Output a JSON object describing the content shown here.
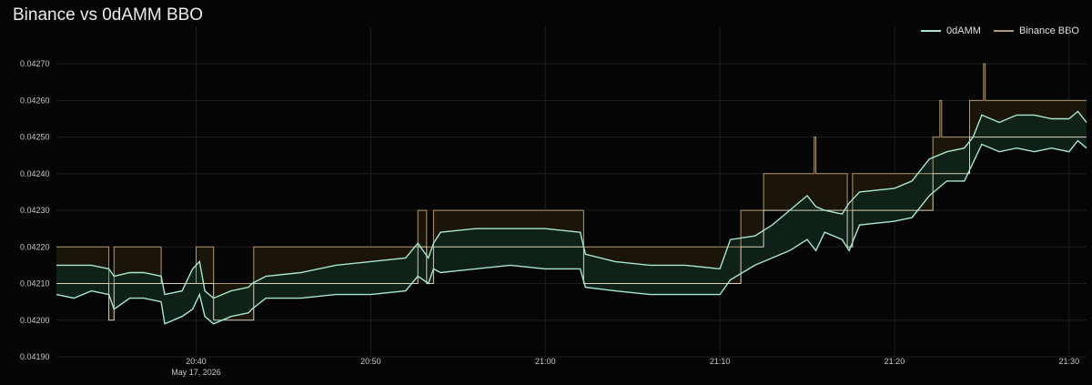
{
  "chart_data": {
    "type": "line",
    "title": "Binance vs 0dAMM BBO",
    "xlabel": "",
    "ylabel": "",
    "date_label": "May 17, 2026",
    "xlim": [
      "20:32",
      "21:31"
    ],
    "ylim": [
      0.0419,
      0.04275
    ],
    "x_ticks": [
      "20:40",
      "20:50",
      "21:00",
      "21:10",
      "21:20",
      "21:30"
    ],
    "y_ticks": [
      "0.04190",
      "0.04200",
      "0.04210",
      "0.04220",
      "0.04230",
      "0.04240",
      "0.04250",
      "0.04260",
      "0.04270"
    ],
    "grid": true,
    "legend_position": "top-right",
    "colors": {
      "background": "#050505",
      "grid": "#1e1e1e",
      "odamm": "#a8e6cf",
      "odamm_fill": "#0f2419",
      "binance": "#b09a70",
      "binance_fill": "#1b1509"
    },
    "series": [
      {
        "name": "0dAMM",
        "color": "#a8e6cf",
        "bid": [
          [
            "20:32",
            0.04207
          ],
          [
            "20:33",
            0.04206
          ],
          [
            "20:34",
            0.04208
          ],
          [
            "20:35",
            0.04207
          ],
          [
            "20:35.3",
            0.04203
          ],
          [
            "20:36.2",
            0.04206
          ],
          [
            "20:37",
            0.04206
          ],
          [
            "20:38",
            0.04205
          ],
          [
            "20:38.2",
            0.04199
          ],
          [
            "20:39.2",
            0.04201
          ],
          [
            "20:39.8",
            0.04203
          ],
          [
            "20:40.2",
            0.04207
          ],
          [
            "20:40.5",
            0.04201
          ],
          [
            "20:41",
            0.04199
          ],
          [
            "20:42",
            0.04201
          ],
          [
            "20:43",
            0.04202
          ],
          [
            "20:43.2",
            0.04203
          ],
          [
            "20:44",
            0.04206
          ],
          [
            "20:46",
            0.04206
          ],
          [
            "20:48",
            0.04207
          ],
          [
            "20:50",
            0.04207
          ],
          [
            "20:52",
            0.04208
          ],
          [
            "20:52.7",
            0.04212
          ],
          [
            "20:53.3",
            0.0421
          ],
          [
            "20:53.6",
            0.04214
          ],
          [
            "20:54",
            0.04213
          ],
          [
            "20:56",
            0.04214
          ],
          [
            "20:58",
            0.04215
          ],
          [
            "21:00",
            0.04214
          ],
          [
            "21:02",
            0.04214
          ],
          [
            "21:02.3",
            0.04209
          ],
          [
            "21:04",
            0.04208
          ],
          [
            "21:06",
            0.04207
          ],
          [
            "21:08",
            0.04207
          ],
          [
            "21:10",
            0.04207
          ],
          [
            "21:10.6",
            0.04211
          ],
          [
            "21:12",
            0.04215
          ],
          [
            "21:13",
            0.04217
          ],
          [
            "21:14",
            0.04219
          ],
          [
            "21:15",
            0.04222
          ],
          [
            "21:15.5",
            0.04219
          ],
          [
            "21:16",
            0.04224
          ],
          [
            "21:17",
            0.04222
          ],
          [
            "21:17.4",
            0.04219
          ],
          [
            "21:18",
            0.04226
          ],
          [
            "21:20",
            0.04227
          ],
          [
            "21:21",
            0.04228
          ],
          [
            "21:22",
            0.04234
          ],
          [
            "21:23",
            0.04238
          ],
          [
            "21:24",
            0.04238
          ],
          [
            "21:24.5",
            0.04243
          ],
          [
            "21:25",
            0.04248
          ],
          [
            "21:26",
            0.04246
          ],
          [
            "21:27",
            0.04247
          ],
          [
            "21:28",
            0.04246
          ],
          [
            "21:29",
            0.04247
          ],
          [
            "21:30",
            0.04246
          ],
          [
            "21:30.5",
            0.04249
          ],
          [
            "21:31",
            0.04247
          ]
        ],
        "ask": [
          [
            "20:32",
            0.04215
          ],
          [
            "20:33",
            0.04215
          ],
          [
            "20:34",
            0.04215
          ],
          [
            "20:35",
            0.04214
          ],
          [
            "20:35.3",
            0.04212
          ],
          [
            "20:36.2",
            0.04213
          ],
          [
            "20:37",
            0.04213
          ],
          [
            "20:38",
            0.04212
          ],
          [
            "20:38.2",
            0.04207
          ],
          [
            "20:39.2",
            0.04208
          ],
          [
            "20:39.8",
            0.04214
          ],
          [
            "20:40.2",
            0.04216
          ],
          [
            "20:40.5",
            0.04208
          ],
          [
            "20:41",
            0.04206
          ],
          [
            "20:42",
            0.04208
          ],
          [
            "20:43",
            0.04209
          ],
          [
            "20:43.2",
            0.0421
          ],
          [
            "20:44",
            0.04212
          ],
          [
            "20:46",
            0.04213
          ],
          [
            "20:48",
            0.04215
          ],
          [
            "20:50",
            0.04216
          ],
          [
            "20:52",
            0.04217
          ],
          [
            "20:52.7",
            0.04221
          ],
          [
            "20:53.3",
            0.04217
          ],
          [
            "20:53.6",
            0.04221
          ],
          [
            "20:54",
            0.04224
          ],
          [
            "20:56",
            0.04225
          ],
          [
            "20:58",
            0.04225
          ],
          [
            "21:00",
            0.04225
          ],
          [
            "21:02",
            0.04224
          ],
          [
            "21:02.3",
            0.04218
          ],
          [
            "21:04",
            0.04216
          ],
          [
            "21:06",
            0.04215
          ],
          [
            "21:08",
            0.04215
          ],
          [
            "21:10",
            0.04214
          ],
          [
            "21:10.6",
            0.04222
          ],
          [
            "21:12",
            0.04223
          ],
          [
            "21:13",
            0.04226
          ],
          [
            "21:14",
            0.0423
          ],
          [
            "21:15",
            0.04234
          ],
          [
            "21:15.5",
            0.04231
          ],
          [
            "21:16",
            0.0423
          ],
          [
            "21:17",
            0.04229
          ],
          [
            "21:17.4",
            0.04232
          ],
          [
            "21:18",
            0.04235
          ],
          [
            "21:20",
            0.04236
          ],
          [
            "21:21",
            0.04238
          ],
          [
            "21:22",
            0.04244
          ],
          [
            "21:23",
            0.04246
          ],
          [
            "21:24",
            0.04247
          ],
          [
            "21:24.5",
            0.0425
          ],
          [
            "21:25",
            0.04256
          ],
          [
            "21:26",
            0.04254
          ],
          [
            "21:27",
            0.04256
          ],
          [
            "21:28",
            0.04256
          ],
          [
            "21:29",
            0.04255
          ],
          [
            "21:30",
            0.04255
          ],
          [
            "21:30.5",
            0.04257
          ],
          [
            "21:31",
            0.04254
          ]
        ]
      },
      {
        "name": "Binance BBO",
        "color": "#b09a70",
        "bid": [
          [
            "20:32",
            0.0421
          ],
          [
            "20:35",
            0.0421
          ],
          [
            "20:35",
            0.042
          ],
          [
            "20:35.3",
            0.042
          ],
          [
            "20:35.3",
            0.0421
          ],
          [
            "20:38",
            0.0421
          ],
          [
            "20:38",
            0.0421
          ],
          [
            "20:40",
            0.0421
          ],
          [
            "20:40",
            0.0421
          ],
          [
            "20:41",
            0.0421
          ],
          [
            "20:41",
            0.042
          ],
          [
            "20:43.3",
            0.042
          ],
          [
            "20:43.3",
            0.0421
          ],
          [
            "20:52.7",
            0.0421
          ],
          [
            "20:52.7",
            0.0422
          ],
          [
            "20:53.2",
            0.0422
          ],
          [
            "20:53.2",
            0.0421
          ],
          [
            "20:53.6",
            0.0421
          ],
          [
            "20:53.6",
            0.0422
          ],
          [
            "21:02.2",
            0.0422
          ],
          [
            "21:02.2",
            0.0421
          ],
          [
            "21:11.2",
            0.0421
          ],
          [
            "21:11.2",
            0.0422
          ],
          [
            "21:12.5",
            0.0422
          ],
          [
            "21:12.5",
            0.0423
          ],
          [
            "21:17.3",
            0.0423
          ],
          [
            "21:17.3",
            0.0422
          ],
          [
            "21:17.6",
            0.0422
          ],
          [
            "21:17.6",
            0.0423
          ],
          [
            "21:22.2",
            0.0423
          ],
          [
            "21:22.2",
            0.0424
          ],
          [
            "21:24.3",
            0.0424
          ],
          [
            "21:24.3",
            0.0425
          ],
          [
            "21:31",
            0.0425
          ]
        ],
        "ask": [
          [
            "20:32",
            0.0422
          ],
          [
            "20:35",
            0.0422
          ],
          [
            "20:35",
            0.0421
          ],
          [
            "20:35.3",
            0.0421
          ],
          [
            "20:35.3",
            0.0422
          ],
          [
            "20:38",
            0.0422
          ],
          [
            "20:38",
            0.0421
          ],
          [
            "20:40",
            0.0421
          ],
          [
            "20:40",
            0.0422
          ],
          [
            "20:41",
            0.0422
          ],
          [
            "20:41",
            0.0421
          ],
          [
            "20:43.3",
            0.0421
          ],
          [
            "20:43.3",
            0.0422
          ],
          [
            "20:52.7",
            0.0422
          ],
          [
            "20:52.7",
            0.0423
          ],
          [
            "20:53.2",
            0.0423
          ],
          [
            "20:53.2",
            0.0422
          ],
          [
            "20:53.6",
            0.0422
          ],
          [
            "20:53.6",
            0.0423
          ],
          [
            "21:02.2",
            0.0423
          ],
          [
            "21:02.2",
            0.0422
          ],
          [
            "21:11.2",
            0.0422
          ],
          [
            "21:11.2",
            0.0423
          ],
          [
            "21:12.5",
            0.0423
          ],
          [
            "21:12.5",
            0.0424
          ],
          [
            "21:15.4",
            0.0424
          ],
          [
            "21:15.4",
            0.0425
          ],
          [
            "21:15.5",
            0.0425
          ],
          [
            "21:15.5",
            0.0424
          ],
          [
            "21:17.3",
            0.0424
          ],
          [
            "21:17.3",
            0.0423
          ],
          [
            "21:17.6",
            0.0423
          ],
          [
            "21:17.6",
            0.0424
          ],
          [
            "21:22.2",
            0.0424
          ],
          [
            "21:22.2",
            0.0425
          ],
          [
            "21:22.6",
            0.0425
          ],
          [
            "21:22.6",
            0.0426
          ],
          [
            "21:22.7",
            0.0426
          ],
          [
            "21:22.7",
            0.0425
          ],
          [
            "21:24.3",
            0.0425
          ],
          [
            "21:24.3",
            0.0426
          ],
          [
            "21:25.1",
            0.0426
          ],
          [
            "21:25.1",
            0.0427
          ],
          [
            "21:25.2",
            0.0427
          ],
          [
            "21:25.2",
            0.0426
          ],
          [
            "21:31",
            0.0426
          ]
        ]
      }
    ]
  }
}
